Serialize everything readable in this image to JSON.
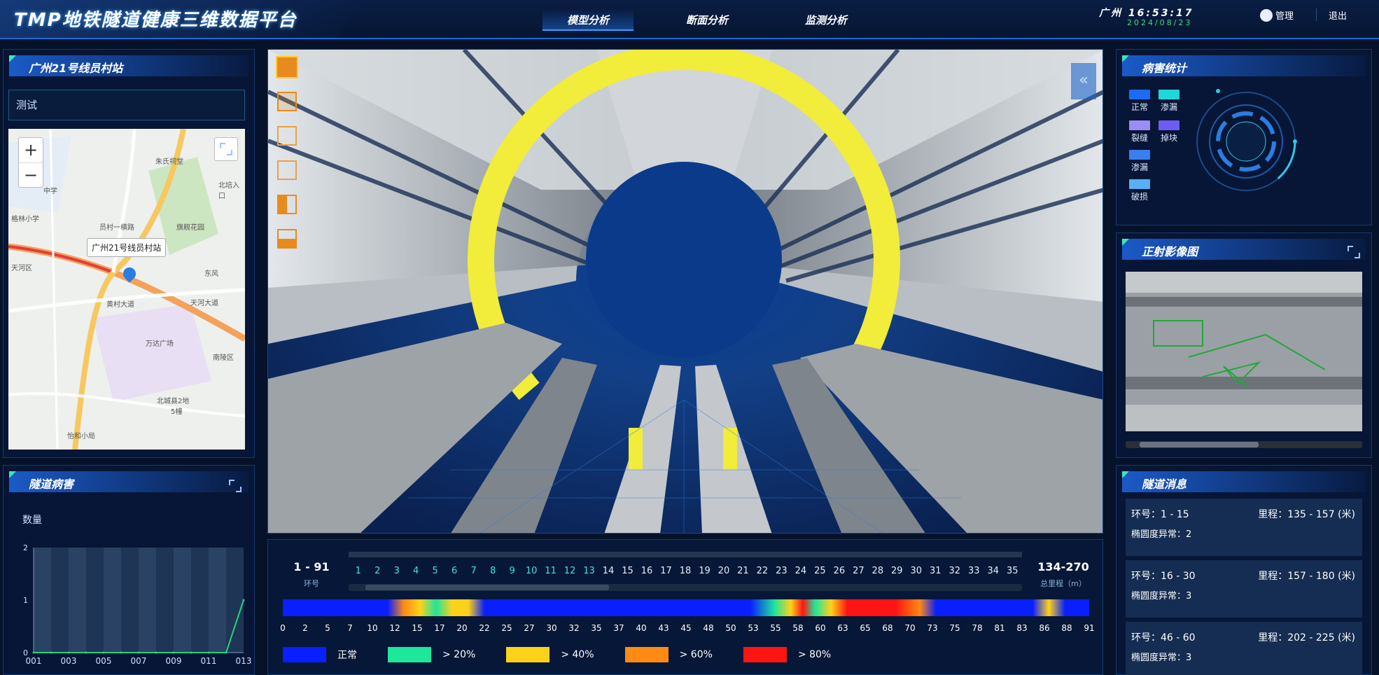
{
  "header": {
    "title": "TMP地铁隧道健康三维数据平台",
    "nav": [
      "模型分析",
      "断面分析",
      "监测分析"
    ],
    "active_nav": 0,
    "city": "广州",
    "time": "16:53:17",
    "date": "2024/08/23",
    "user": "管理",
    "logout": "退出"
  },
  "station_panel": {
    "title": "广州21号线员村站",
    "input_value": "测试",
    "map_tooltip": "广州21号线员村站",
    "map_labels": [
      "朱氏祠堂",
      "北培入口",
      "中学",
      "格林小学",
      "旗舰花园",
      "员村一横路",
      "天河大道",
      "天河区",
      "万达广场",
      "黄村大道",
      "北城县2地",
      "怡和小局",
      "5幢",
      "东风",
      "南陵区"
    ]
  },
  "viewer": {
    "tools": [
      "solid-cube-icon",
      "box-icon",
      "wire-cube-icon",
      "wire-cube-2-icon",
      "half-cube-icon",
      "section-cube-icon"
    ],
    "collapse": "«"
  },
  "ring_bar": {
    "ring_range": "1 - 91",
    "ring_label": "环号",
    "mileage_range": "134-270",
    "mileage_label": "总里程（m）",
    "rings": [
      "1",
      "2",
      "3",
      "4",
      "5",
      "6",
      "7",
      "8",
      "9",
      "10",
      "11",
      "12",
      "13",
      "14",
      "15",
      "16",
      "17",
      "18",
      "19",
      "20",
      "21",
      "22",
      "23",
      "24",
      "25",
      "26",
      "27",
      "28",
      "29",
      "30",
      "31",
      "32",
      "33",
      "34",
      "35"
    ],
    "done_count": 13,
    "ticks": [
      "0",
      "2",
      "5",
      "7",
      "10",
      "12",
      "15",
      "17",
      "20",
      "22",
      "25",
      "27",
      "30",
      "32",
      "35",
      "37",
      "40",
      "43",
      "45",
      "48",
      "50",
      "53",
      "55",
      "58",
      "60",
      "63",
      "65",
      "68",
      "70",
      "73",
      "75",
      "78",
      "81",
      "83",
      "86",
      "88",
      "91"
    ],
    "legend": [
      {
        "label": "正常",
        "color": "#0a1fff"
      },
      {
        "label": "> 20%",
        "color": "#1de79a"
      },
      {
        "label": "> 40%",
        "color": "#ffd21a"
      },
      {
        "label": "> 60%",
        "color": "#ff8a14"
      },
      {
        "label": "> 80%",
        "color": "#ff1414"
      }
    ]
  },
  "disease_panel": {
    "title": "隧道病害",
    "ylabel": "数量"
  },
  "chart_data": {
    "type": "line",
    "title": "",
    "xlabel": "",
    "ylabel": "数量",
    "categories": [
      "001",
      "002",
      "003",
      "004",
      "005",
      "006",
      "007",
      "008",
      "009",
      "010",
      "011",
      "012",
      "013"
    ],
    "x_tick_labels": [
      "001",
      "003",
      "005",
      "007",
      "009",
      "011",
      "013"
    ],
    "values": [
      0,
      0,
      0,
      0,
      0,
      0,
      0,
      0,
      0,
      0,
      0,
      0,
      1
    ],
    "ylim": [
      0,
      2
    ],
    "yticks": [
      "0",
      "1",
      "2"
    ],
    "grid": false
  },
  "stats_panel": {
    "title": "病害统计",
    "legend": [
      {
        "label": "正常",
        "color": "#1b6cf0"
      },
      {
        "label": "渗漏",
        "color": "#1ed7d7"
      },
      {
        "label": "裂缝",
        "color": "#9b8cf7"
      },
      {
        "label": "掉块",
        "color": "#6d5cf2"
      },
      {
        "label": "渗漏",
        "color": "#3a7ef2"
      },
      {
        "label": "破损",
        "color": "#5aaef2"
      }
    ]
  },
  "ortho_panel": {
    "title": "正射影像图"
  },
  "info_panel": {
    "title": "隧道消息",
    "items": [
      {
        "ring": "环号：1 - 15",
        "mileage": "里程：135 - 157 (米)",
        "ellipse": "椭圆度异常：2"
      },
      {
        "ring": "环号：16 - 30",
        "mileage": "里程：157 - 180 (米)",
        "ellipse": "椭圆度异常：3"
      },
      {
        "ring": "环号：46 - 60",
        "mileage": "里程：202 - 225 (米)",
        "ellipse": "椭圆度异常：3"
      }
    ]
  }
}
